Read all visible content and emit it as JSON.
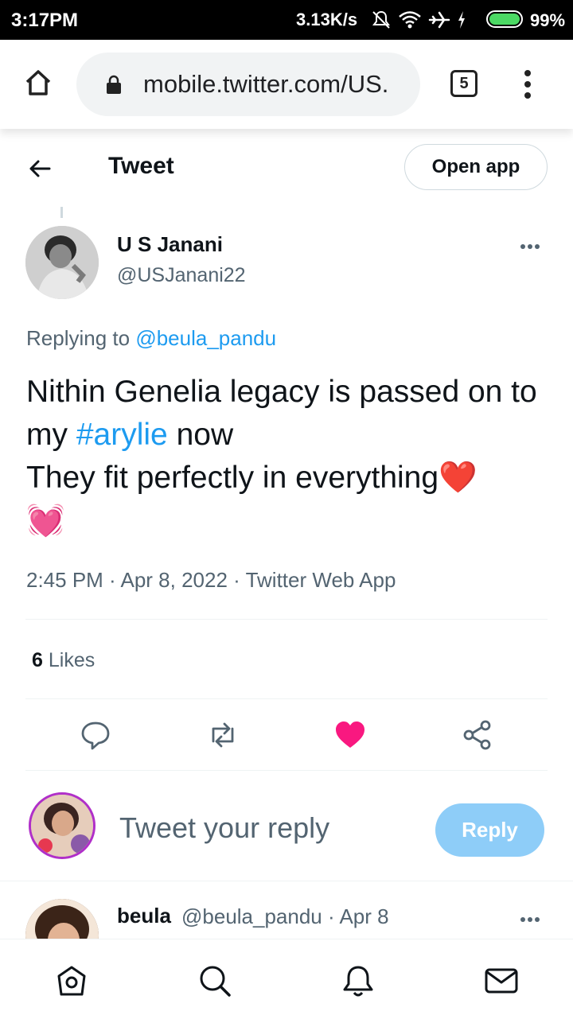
{
  "status_bar": {
    "time": "3:17PM",
    "net_speed": "3.13K/s",
    "battery_percent": "99%",
    "icons": [
      "mute-icon",
      "wifi-icon",
      "airplane-icon",
      "charging-icon",
      "battery-icon"
    ]
  },
  "browser": {
    "url": "mobile.twitter.com/US.",
    "tab_count": "5",
    "icons": [
      "home-icon",
      "lock-icon",
      "menu-dots-icon"
    ]
  },
  "header": {
    "title": "Tweet",
    "open_app_label": "Open app",
    "back_icon": "arrow-left-icon"
  },
  "tweet": {
    "author_name": "U S Janani",
    "author_handle": "@USJanani22",
    "replying_prefix": "Replying to",
    "replying_to": "@beula_pandu",
    "text_part1": "Nithin Genelia legacy is passed on to my",
    "hashtag": "#arylie",
    "text_part2": "now",
    "text_line3": "They fit perfectly in everything❤️",
    "emoji_line": "💓",
    "time": "2:45 PM",
    "date": "Apr 8, 2022",
    "source": "Twitter Web App",
    "likes_count": "6",
    "likes_label": "Likes",
    "actions": [
      "reply-icon",
      "retweet-icon",
      "like-icon",
      "share-icon"
    ],
    "liked_color": "#f91880"
  },
  "reply_box": {
    "placeholder": "Tweet your reply",
    "button_label": "Reply",
    "button_color": "#8ecdf8"
  },
  "next_reply": {
    "name": "beula",
    "handle": "@beula_pandu",
    "date": "Apr 8"
  },
  "bottom_nav": [
    "home-icon",
    "search-icon",
    "notifications-icon",
    "messages-icon"
  ],
  "colors": {
    "accent": "#1d9bf0",
    "secondary_text": "#536471"
  }
}
